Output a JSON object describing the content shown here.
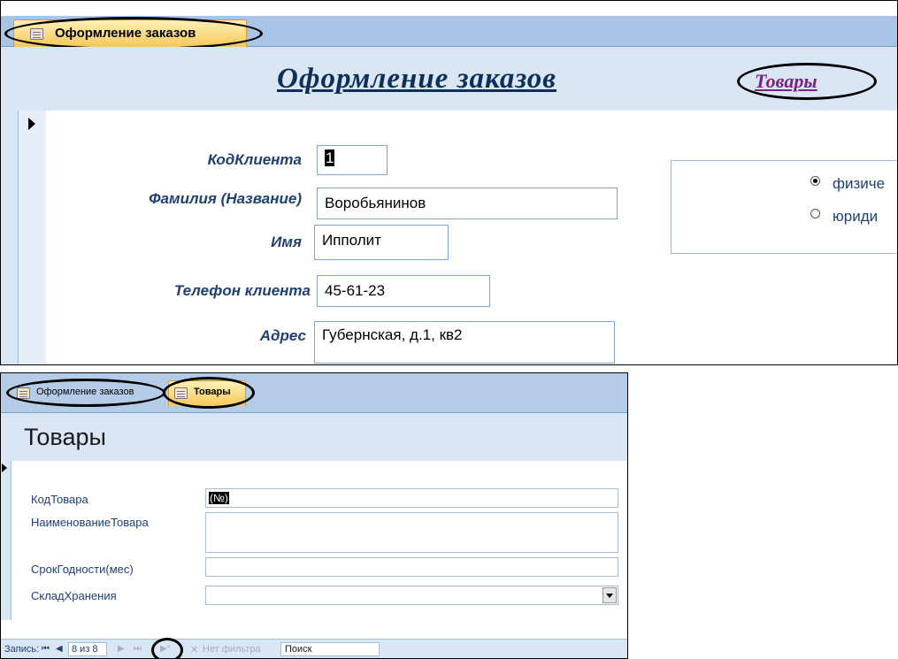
{
  "top": {
    "tab_label": "Оформление заказов",
    "title": "Оформление заказов",
    "link_label": "Товары",
    "fields": [
      {
        "label": "КодКлиента",
        "value": "1"
      },
      {
        "label": "Фамилия (Название)",
        "value": "Воробьянинов"
      },
      {
        "label": "Имя",
        "value": "Ипполит"
      },
      {
        "label": "Телефон клиента",
        "value": "45-61-23"
      },
      {
        "label": "Адрес",
        "value": "Губернская, д.1, кв2"
      }
    ],
    "options": [
      {
        "label": "физиче",
        "selected": true
      },
      {
        "label": "юриди",
        "selected": false
      }
    ]
  },
  "bottom": {
    "tabs": [
      {
        "label": "Оформление заказов",
        "active": false
      },
      {
        "label": "Товары",
        "active": true
      }
    ],
    "title": "Товары",
    "fields": [
      {
        "label": "КодТовара",
        "value": "(№)"
      },
      {
        "label": "НаименованиеТовара",
        "value": ""
      },
      {
        "label": "СрокГодности(мес)",
        "value": ""
      },
      {
        "label": "СкладХранения",
        "value": ""
      }
    ],
    "nav": {
      "record_label": "Запись:",
      "position": "8 из 8",
      "filter_label": "Нет фильтра",
      "search_label": "Поиск"
    }
  },
  "icons": [
    "form-icon",
    "record-selector-icon",
    "dropdown-arrow-icon",
    "first-record-icon",
    "prev-record-icon",
    "next-record-icon",
    "last-record-icon",
    "new-record-icon",
    "filter-icon"
  ],
  "colors": {
    "tab_active": "#f6c85a",
    "header_bg": "#dbe6f5",
    "label_color": "#1f3f76",
    "link_color": "#7b1f8a"
  }
}
